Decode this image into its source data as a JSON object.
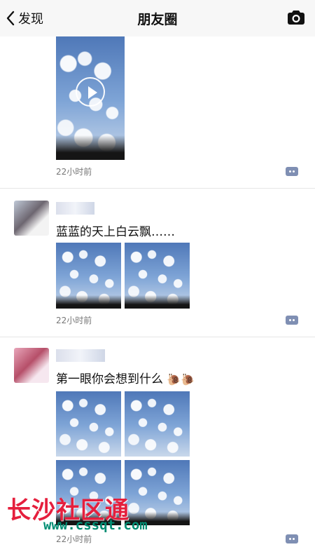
{
  "nav": {
    "back_label": "发现",
    "title": "朋友圈"
  },
  "posts": [
    {
      "time": "22小时前",
      "media_type": "video"
    },
    {
      "text": "蓝蓝的天上白云飘……",
      "time": "22小时前"
    },
    {
      "text": "第一眼你会想到什么",
      "emoji": "🐌🐌",
      "time": "22小时前"
    }
  ],
  "watermark": {
    "cn": "长沙社区通",
    "url": "www.cssqt.com"
  }
}
